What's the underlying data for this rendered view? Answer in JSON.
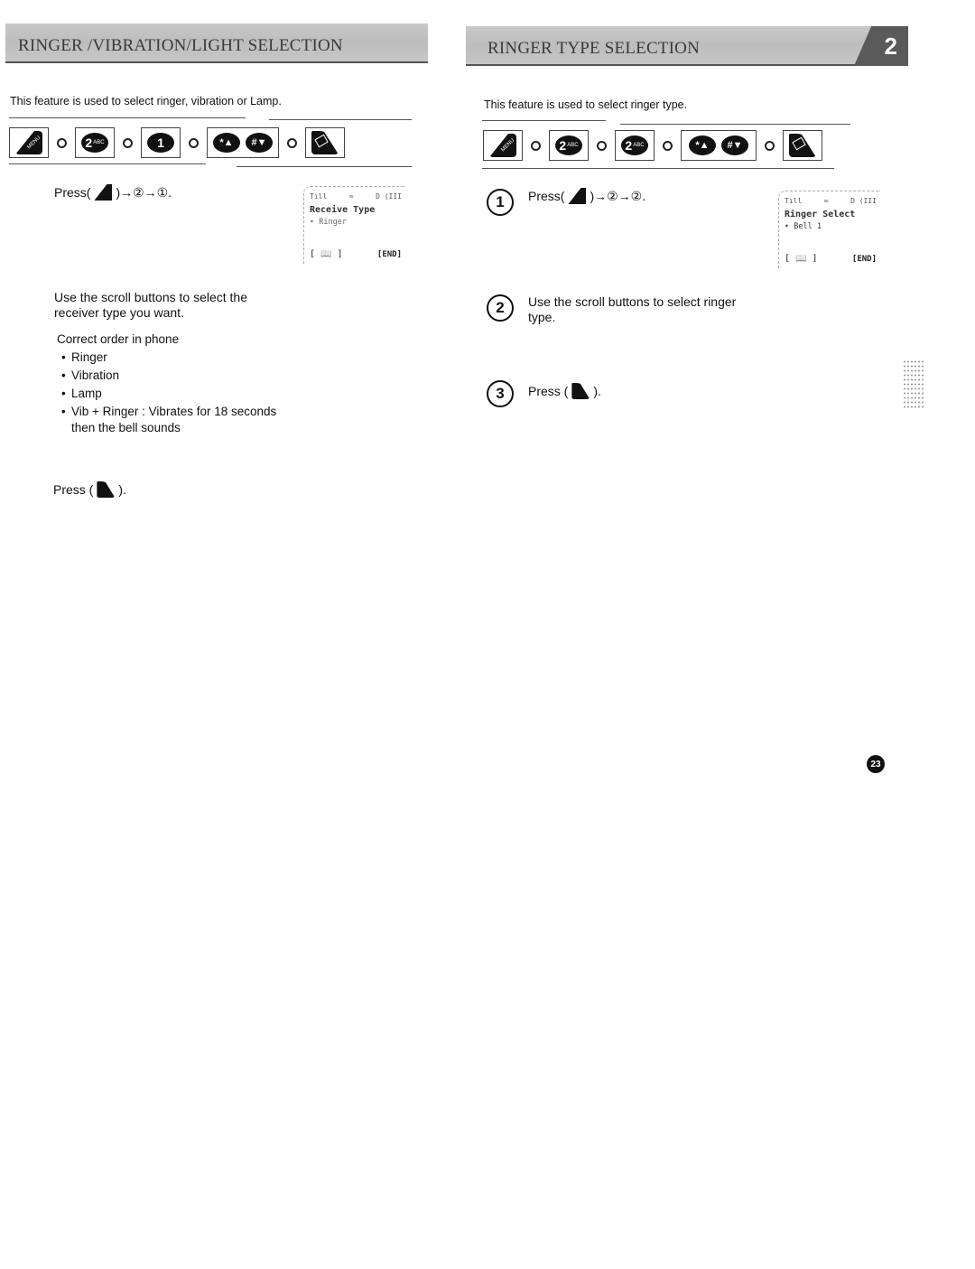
{
  "left": {
    "header_title": "Ringer /Vibration/Light Selection",
    "intro": "This feature is used to select ringer, vibration or Lamp.",
    "key_sequence": [
      {
        "type": "menu",
        "label": "MENU"
      },
      {
        "type": "digit",
        "label": "2",
        "sub": "ABC"
      },
      {
        "type": "digit",
        "label": "1",
        "sub": ""
      },
      {
        "type": "scroll",
        "up": "*▲",
        "down": "#▼"
      },
      {
        "type": "end",
        "label": "END"
      }
    ],
    "step1": {
      "prefix": "Press(",
      "suffix": ")→②→①."
    },
    "lcd": {
      "signal": "Tıll",
      "mid_icon": "≈",
      "right_icons": "D (III",
      "title": "Receive Type",
      "option_arrow": "➧",
      "option": "Ringer",
      "softkey_left": "[ 📖 ]",
      "softkey_right": "[END]"
    },
    "step2": "Use the scroll buttons to select the receiver type you want.",
    "order_heading": "Correct order in phone",
    "order_items": [
      "Ringer",
      "Vibration",
      "Lamp",
      "Vib + Ringer : Vibrates for 18 seconds"
    ],
    "order_item_continuation": "then the bell sounds",
    "step3": {
      "prefix": "Press (",
      "suffix": ")."
    }
  },
  "right": {
    "header_title": "Ringer Type Selection",
    "chapter": "2",
    "intro": "This feature is used to select ringer type.",
    "key_sequence": [
      {
        "type": "menu",
        "label": "MENU"
      },
      {
        "type": "digit",
        "label": "2",
        "sub": "ABC"
      },
      {
        "type": "digit",
        "label": "2",
        "sub": "ABC"
      },
      {
        "type": "scroll",
        "up": "*▲",
        "down": "#▼"
      },
      {
        "type": "end",
        "label": "END"
      }
    ],
    "steps": [
      {
        "num": "1",
        "prefix": "Press(",
        "suffix": ")→②→②."
      },
      {
        "num": "2",
        "text": "Use the scroll buttons to select ringer type."
      },
      {
        "num": "3",
        "prefix": "Press (",
        "suffix": ")."
      }
    ],
    "lcd": {
      "signal": "Tıll",
      "mid_icon": "≈",
      "right_icons": "D (III",
      "title": "Ringer Select",
      "option_arrow": "➧",
      "option": "Bell 1",
      "softkey_left": "[ 📖 ]",
      "softkey_right": "[END]"
    }
  },
  "page_number": "23"
}
